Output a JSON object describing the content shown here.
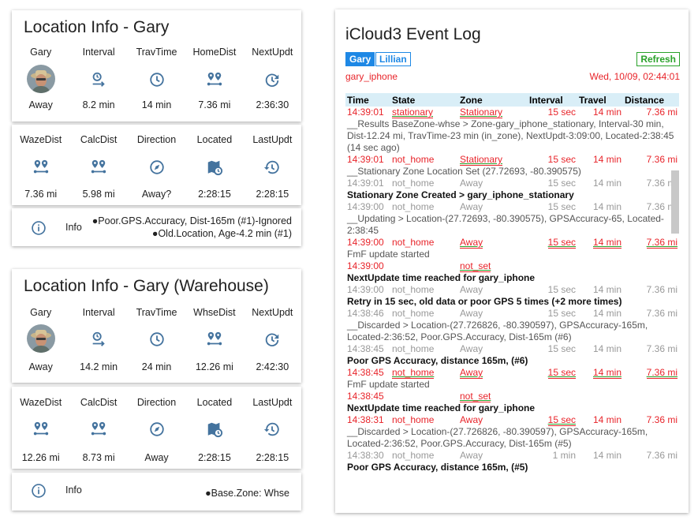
{
  "card1": {
    "title": "Location Info - Gary",
    "row1": [
      {
        "label": "Gary",
        "icon": "avatar",
        "value": "Away"
      },
      {
        "label": "Interval",
        "icon": "timer-arrow-icon",
        "value": "8.2 min"
      },
      {
        "label": "TravTime",
        "icon": "clock-icon",
        "value": "14 min"
      },
      {
        "label": "HomeDist",
        "icon": "map-marker-distance-icon",
        "value": "7.36 mi"
      },
      {
        "label": "NextUpdt",
        "icon": "update-icon",
        "value": "2:36:30"
      }
    ],
    "row2": [
      {
        "label": "WazeDist",
        "icon": "map-marker-distance-icon",
        "value": "7.36 mi"
      },
      {
        "label": "CalcDist",
        "icon": "map-marker-distance-icon",
        "value": "5.98 mi"
      },
      {
        "label": "Direction",
        "icon": "compass-icon",
        "value": "Away?"
      },
      {
        "label": "Located",
        "icon": "map-clock-icon",
        "value": "2:28:15"
      },
      {
        "label": "LastUpdt",
        "icon": "history-icon",
        "value": "2:28:15"
      }
    ],
    "info_label": "Info",
    "info_lines": [
      "●Poor.GPS.Accuracy, Dist-165m (#1)-Ignored",
      "●Old.Location, Age-4.2 min (#1)"
    ]
  },
  "card2": {
    "title": "Location Info - Gary (Warehouse)",
    "row1": [
      {
        "label": "Gary",
        "icon": "avatar",
        "value": "Away"
      },
      {
        "label": "Interval",
        "icon": "timer-arrow-icon",
        "value": "14.2 min"
      },
      {
        "label": "TravTime",
        "icon": "clock-icon",
        "value": "24 min"
      },
      {
        "label": "WhseDist",
        "icon": "map-marker-distance-icon",
        "value": "12.26 mi"
      },
      {
        "label": "NextUpdt",
        "icon": "update-icon",
        "value": "2:42:30"
      }
    ],
    "row2": [
      {
        "label": "WazeDist",
        "icon": "map-marker-distance-icon",
        "value": "12.26 mi"
      },
      {
        "label": "CalcDist",
        "icon": "map-marker-distance-icon",
        "value": "8.73 mi"
      },
      {
        "label": "Direction",
        "icon": "compass-icon",
        "value": "Away"
      },
      {
        "label": "Located",
        "icon": "map-clock-icon",
        "value": "2:28:15"
      },
      {
        "label": "LastUpdt",
        "icon": "history-icon",
        "value": "2:28:15"
      }
    ],
    "info_label": "Info",
    "info_lines": [
      "●Base.Zone: Whse"
    ]
  },
  "eventlog": {
    "title": "iCloud3 Event Log",
    "tabs": [
      "Gary",
      "Lillian"
    ],
    "refresh_label": "Refresh",
    "device": "gary_iphone",
    "datetime": "Wed, 10/09, 02:44:01",
    "headers": [
      "Time",
      "State",
      "Zone",
      "Interval",
      "Travel",
      "Distance"
    ],
    "rows": [
      {
        "kind": "data",
        "style": "red",
        "time": "14:39:01",
        "state": "stationary",
        "zone": "Stationary",
        "interval": "15 sec",
        "travel": "14 min",
        "distance": "7.36 mi",
        "ul": [
          "state",
          "zone"
        ]
      },
      {
        "kind": "msg",
        "text": "__Results BaseZone-whse > Zone-gary_iphone_stationary, Interval-30 min, Dist-12.24 mi, TravTime-23 min (in_zone), NextUpdt-3:09:00, Located-2:38:45 (14 sec ago)"
      },
      {
        "kind": "data",
        "style": "red",
        "time": "14:39:01",
        "state": "not_home",
        "zone": "Stationary",
        "interval": "15 sec",
        "travel": "14 min",
        "distance": "7.36 mi",
        "ul": [
          "zone"
        ]
      },
      {
        "kind": "msg",
        "text": "__Stationary Zone Location Set (27.72693, -80.390575)"
      },
      {
        "kind": "data",
        "style": "grey",
        "time": "14:39:01",
        "state": "not_home",
        "zone": "Away",
        "interval": "15 sec",
        "travel": "14 min",
        "distance": "7.36 mi",
        "ul": []
      },
      {
        "kind": "bold",
        "text": "Stationary Zone Created > gary_iphone_stationary"
      },
      {
        "kind": "data",
        "style": "grey",
        "time": "14:39:00",
        "state": "not_home",
        "zone": "Away",
        "interval": "15 sec",
        "travel": "14 min",
        "distance": "7.36 mi",
        "ul": []
      },
      {
        "kind": "msg",
        "text": "__Updating > Location-(27.72693, -80.390575), GPSAccuracy-65, Located-2:38:45"
      },
      {
        "kind": "data",
        "style": "red",
        "time": "14:39:00",
        "state": "not_home",
        "zone": "Away",
        "interval": "15 sec",
        "travel": "14 min",
        "distance": "7.36 mi",
        "ul": [
          "zone",
          "interval",
          "travel",
          "distance"
        ]
      },
      {
        "kind": "blue",
        "text": "FmF update started"
      },
      {
        "kind": "data",
        "style": "red",
        "time": "14:39:00",
        "state": "",
        "zone": "not_set",
        "interval": "",
        "travel": "",
        "distance": "",
        "ul": [
          "zone"
        ]
      },
      {
        "kind": "bold",
        "text": "NextUpdate time reached for gary_iphone"
      },
      {
        "kind": "data",
        "style": "grey",
        "time": "14:39:00",
        "state": "not_home",
        "zone": "Away",
        "interval": "15 sec",
        "travel": "14 min",
        "distance": "7.36 mi",
        "ul": []
      },
      {
        "kind": "bold",
        "text": "Retry in 15 sec, old data or poor GPS 5 times (+2 more times)"
      },
      {
        "kind": "data",
        "style": "grey",
        "time": "14:38:46",
        "state": "not_home",
        "zone": "Away",
        "interval": "15 sec",
        "travel": "14 min",
        "distance": "7.36 mi",
        "ul": []
      },
      {
        "kind": "msg",
        "text": "__Discarded > Location-(27.726826, -80.390597), GPSAccuracy-165m, Located-2:36:52, Poor.GPS.Accuracy, Dist-165m (#6)"
      },
      {
        "kind": "data",
        "style": "grey",
        "time": "14:38:45",
        "state": "not_home",
        "zone": "Away",
        "interval": "15 sec",
        "travel": "14 min",
        "distance": "7.36 mi",
        "ul": []
      },
      {
        "kind": "bold",
        "text": "Poor GPS Accuracy, distance 165m, (#6)"
      },
      {
        "kind": "data",
        "style": "red",
        "time": "14:38:45",
        "state": "not_home",
        "zone": "Away",
        "interval": "15 sec",
        "travel": "14 min",
        "distance": "7.36 mi",
        "ul": [
          "state",
          "zone",
          "interval",
          "travel",
          "distance"
        ]
      },
      {
        "kind": "blue",
        "text": "FmF update started"
      },
      {
        "kind": "data",
        "style": "red",
        "time": "14:38:45",
        "state": "",
        "zone": "not_set",
        "interval": "",
        "travel": "",
        "distance": "",
        "ul": [
          "zone"
        ]
      },
      {
        "kind": "bold",
        "text": "NextUpdate time reached for gary_iphone"
      },
      {
        "kind": "data",
        "style": "red",
        "time": "14:38:31",
        "state": "not_home",
        "zone": "Away",
        "interval": "15 sec",
        "travel": "14 min",
        "distance": "7.36 mi",
        "ul": [
          "interval"
        ]
      },
      {
        "kind": "msg",
        "text": "__Discarded > Location-(27.726826, -80.390597), GPSAccuracy-165m, Located-2:36:52, Poor.GPS.Accuracy, Dist-165m (#5)"
      },
      {
        "kind": "data",
        "style": "grey",
        "time": "14:38:30",
        "state": "not_home",
        "zone": "Away",
        "interval": "1 min",
        "travel": "14 min",
        "distance": "7.36 mi",
        "ul": []
      },
      {
        "kind": "bold",
        "text": "Poor GPS Accuracy, distance 165m, (#5)"
      }
    ]
  },
  "colors": {
    "icon_blue": "#44739e",
    "red": "#e8242a",
    "green": "#2aa22a",
    "header_bg": "#d9eef7",
    "tab_blue": "#1e88e5"
  }
}
